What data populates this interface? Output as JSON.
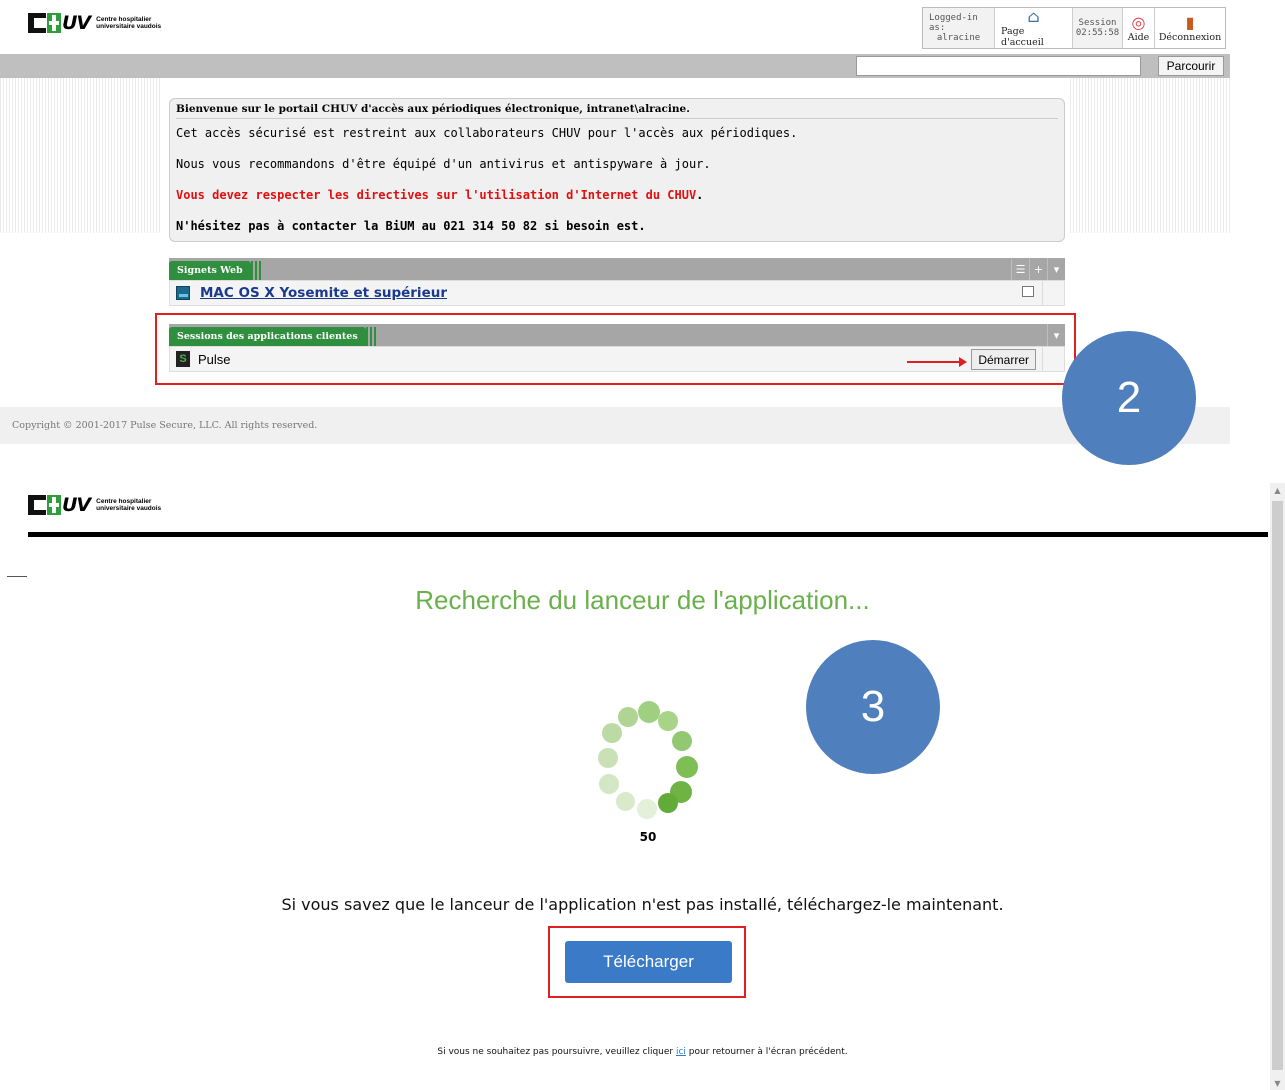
{
  "portal": {
    "logo": {
      "line1": "Centre hospitalier",
      "line2": "universitaire vaudois",
      "uv": "UV"
    },
    "topnav": {
      "logged_label": "Logged-in as:",
      "logged_user": "alracine",
      "home_label": "Page d'accueil",
      "session_label": "Session",
      "session_time": "02:55:58",
      "help_label": "Aide",
      "logout_label": "Déconnexion"
    },
    "search": {
      "value": "",
      "button": "Parcourir"
    },
    "welcome": {
      "title": "Bienvenue sur le portail CHUV d'accès aux périodiques électronique, intranet\\alracine.",
      "line1": "Cet accès sécurisé est restreint aux collaborateurs CHUV pour l'accès aux périodiques.",
      "line2": "Nous vous recommandons d'être équipé d'un antivirus et antispyware à jour.",
      "line3": "Vous devez respecter les directives sur l'utilisation d'Internet du CHUV",
      "line3_dot": ".",
      "line4": "N'hésitez pas à contacter la BiUM au 021 314 50 82 si besoin est."
    },
    "bookmarks": {
      "tab": "Signets Web",
      "item": "MAC OS X Yosemite et supérieur"
    },
    "sessions": {
      "tab": "Sessions des applications clientes",
      "app": "Pulse",
      "start": "Démarrer"
    },
    "footer": "Copyright © 2001-2017 Pulse Secure, LLC. All rights reserved."
  },
  "steps": {
    "step2": "2",
    "step3": "3"
  },
  "launcher": {
    "title": "Recherche du lanceur de l'application...",
    "counter": "50",
    "info": "Si vous savez que le lanceur de l'application n'est pas installé, téléchargez-le maintenant.",
    "download": "Télécharger",
    "back_before": "Si vous ne souhaitez pas poursuivre, veuillez cliquer ",
    "back_link": "ici",
    "back_after": " pour retourner à l'écran précédent."
  },
  "colors": {
    "accent_green": "#6ab04c",
    "button_blue": "#3a7ac7",
    "step_blue": "#4f7fbd",
    "highlight_red": "#e02020",
    "tab_green": "#2f8f3e"
  }
}
